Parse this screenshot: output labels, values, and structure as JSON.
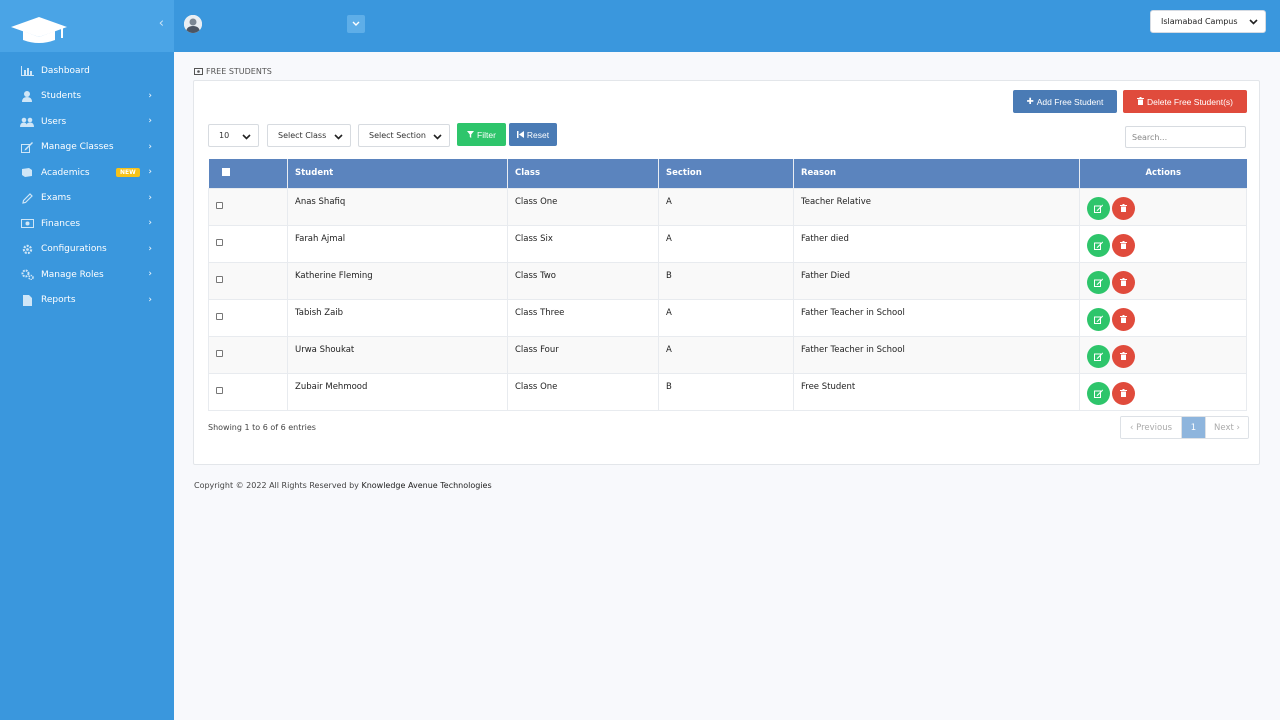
{
  "sidebar": {
    "items": [
      {
        "label": "Dashboard",
        "icon": "bar-chart-icon",
        "has_chevron": false
      },
      {
        "label": "Students",
        "icon": "user-icon",
        "has_chevron": true
      },
      {
        "label": "Users",
        "icon": "users-icon",
        "has_chevron": true
      },
      {
        "label": "Manage Classes",
        "icon": "edit-icon",
        "has_chevron": true
      },
      {
        "label": "Academics",
        "icon": "book-icon",
        "has_chevron": true,
        "badge": "NEW"
      },
      {
        "label": "Exams",
        "icon": "pencil-icon",
        "has_chevron": true
      },
      {
        "label": "Finances",
        "icon": "money-icon",
        "has_chevron": true
      },
      {
        "label": "Configurations",
        "icon": "gear-icon",
        "has_chevron": true
      },
      {
        "label": "Manage Roles",
        "icon": "gears-icon",
        "has_chevron": true
      },
      {
        "label": "Reports",
        "icon": "file-icon",
        "has_chevron": true
      }
    ]
  },
  "topbar": {
    "campus": "Islamabad Campus"
  },
  "page": {
    "title": "FREE STUDENTS",
    "add_label": "Add Free Student",
    "delete_label": "Delete Free Student(s)",
    "length_value": "10",
    "class_select": "Select Class",
    "section_select": "Select Section",
    "filter_label": "Filter",
    "reset_label": "Reset",
    "search_placeholder": "Search..."
  },
  "table": {
    "columns": [
      "Student",
      "Class",
      "Section",
      "Reason",
      "Actions"
    ],
    "rows": [
      {
        "student": "Anas Shafiq",
        "class": "Class One",
        "section": "A",
        "reason": "Teacher Relative"
      },
      {
        "student": "Farah Ajmal",
        "class": "Class Six",
        "section": "A",
        "reason": "Father died"
      },
      {
        "student": "Katherine Fleming",
        "class": "Class Two",
        "section": "B",
        "reason": "Father Died"
      },
      {
        "student": "Tabish Zaib",
        "class": "Class Three",
        "section": "A",
        "reason": "Father Teacher in School"
      },
      {
        "student": "Urwa Shoukat",
        "class": "Class Four",
        "section": "A",
        "reason": "Father Teacher in School"
      },
      {
        "student": "Zubair Mehmood",
        "class": "Class One",
        "section": "B",
        "reason": "Free Student"
      }
    ]
  },
  "table_info": "Showing 1 to 6 of 6 entries",
  "pagination": {
    "previous": "Previous",
    "current": "1",
    "next": "Next"
  },
  "footer": {
    "text": "Copyright © 2022 All Rights Reserved by",
    "company": "Knowledge Avenue Technologies"
  },
  "colors": {
    "primary": "#3a97dd",
    "header": "#5b84be",
    "success": "#2ec56b",
    "danger": "#e04b3c",
    "badge": "#f6c21a"
  }
}
